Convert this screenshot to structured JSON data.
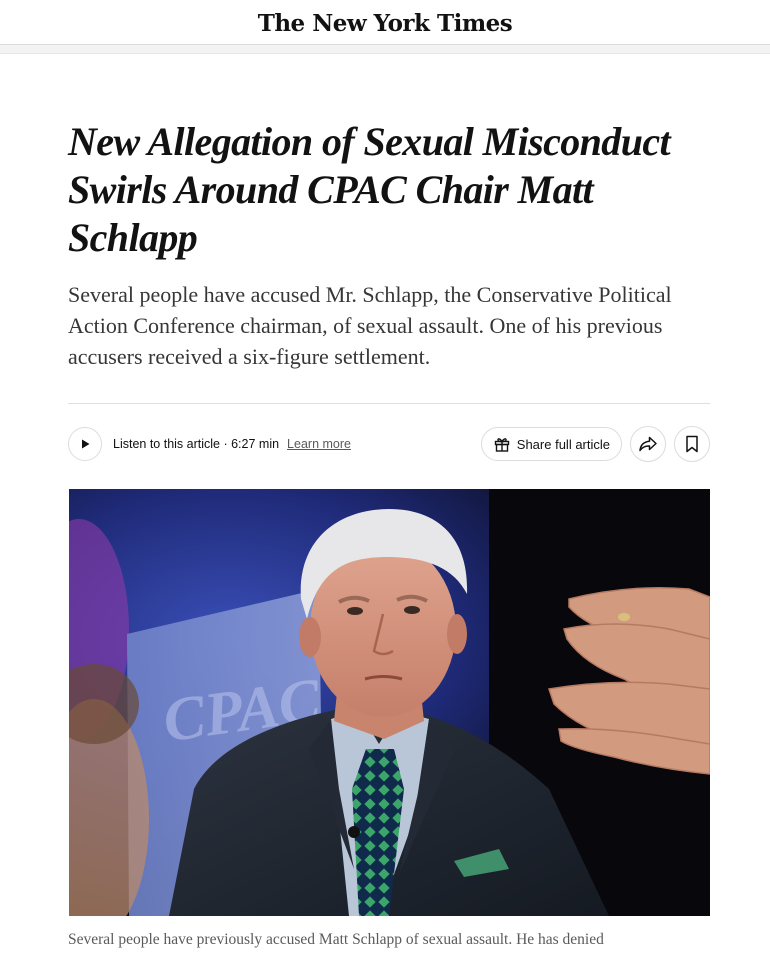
{
  "masthead": {
    "logo": "The New York Times"
  },
  "article": {
    "headline": "New Allegation of Sexual Misconduct Swirls Around CPAC Chair Matt Schlapp",
    "summary": "Several people have accused Mr. Schlapp, the Conservative Political Action Conference chairman, of sexual assault. One of his previous accusers received a six-figure settlement."
  },
  "toolbar": {
    "listen_label": "Listen to this article · 6:27 min",
    "learn_more": "Learn more",
    "share_full_article": "Share full article"
  },
  "photo": {
    "alt": "Matt Schlapp at CPAC",
    "backdrop_logo": "CPAC"
  },
  "caption": {
    "text": "Several people have previously accused Matt Schlapp of sexual assault. He has denied"
  },
  "icons": {
    "play": "play-icon",
    "gift": "gift-icon",
    "share": "share-arrow-icon",
    "bookmark": "bookmark-icon"
  },
  "colors": {
    "text": "#121212",
    "summary": "#363636",
    "caption": "#5a5a5a",
    "border": "#dcdcdc"
  }
}
